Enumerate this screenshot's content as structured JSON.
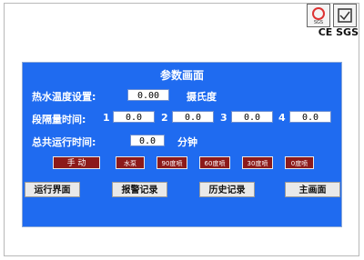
{
  "panel": {
    "title": "参数画面"
  },
  "hot_water": {
    "label": "热水温度设置:",
    "value": "0.00",
    "unit": "摄氏度"
  },
  "segments": {
    "label": "段隔量时间:",
    "items": [
      {
        "index": "1",
        "value": "0.0"
      },
      {
        "index": "2",
        "value": "0.0"
      },
      {
        "index": "3",
        "value": "0.0"
      },
      {
        "index": "4",
        "value": "0.0"
      }
    ]
  },
  "total_time": {
    "label": "总共运行时间:",
    "value": "0.0",
    "unit": "分钟"
  },
  "buttons": [
    "手 动",
    "水泵",
    "90度喷",
    "60度喷",
    "30度喷",
    "0度喷"
  ],
  "nav": [
    "运行界面",
    "报警记录",
    "历史记录",
    "主画面"
  ],
  "certification": {
    "text": "CE SGS",
    "badge_text": "SGS"
  },
  "colors": {
    "panel": "#1f6bf0",
    "button": "#8c1a1a",
    "nav": "#e9e9e9"
  }
}
